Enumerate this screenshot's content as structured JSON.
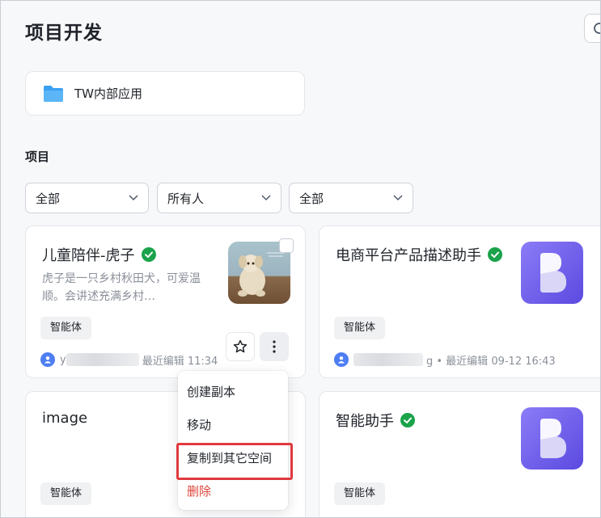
{
  "page": {
    "title": "项目开发"
  },
  "folder": {
    "name": "TW内部应用",
    "icon": "folder-icon"
  },
  "section": {
    "title": "项目"
  },
  "filters": [
    {
      "label": "全部"
    },
    {
      "label": "所有人"
    },
    {
      "label": "全部"
    }
  ],
  "cards": [
    {
      "title": "儿童陪伴-虎子",
      "desc": "虎子是一只乡村秋田犬，可爱温顺。会讲述充满乡村…",
      "tag": "智能体",
      "meta": "最近编辑 11:34",
      "author_prefix": "y",
      "thumb": "plush-toy-photo",
      "verified": true
    },
    {
      "title": "电商平台产品描述助手",
      "desc": "",
      "tag": "智能体",
      "meta": "g • 最近编辑 09-12 16:43",
      "author_prefix": "",
      "thumb": "app-logo",
      "verified": true
    },
    {
      "title": "image",
      "desc": "",
      "tag": "智能体",
      "meta": "",
      "author_prefix": "",
      "thumb": "",
      "verified": false
    },
    {
      "title": "智能助手",
      "desc": "",
      "tag": "智能体",
      "meta": "",
      "author_prefix": "",
      "thumb": "app-logo",
      "verified": true
    }
  ],
  "menu": {
    "items": [
      {
        "label": "创建副本"
      },
      {
        "label": "移动"
      },
      {
        "label": "复制到其它空间"
      },
      {
        "label": "删除"
      }
    ]
  },
  "colors": {
    "accent": "#4e7ef3",
    "verified": "#1aa34a",
    "danger": "#e0453b",
    "highlight": "#e0393e",
    "app_logo": "#6b5bea",
    "folder": "#3aa0f2"
  }
}
